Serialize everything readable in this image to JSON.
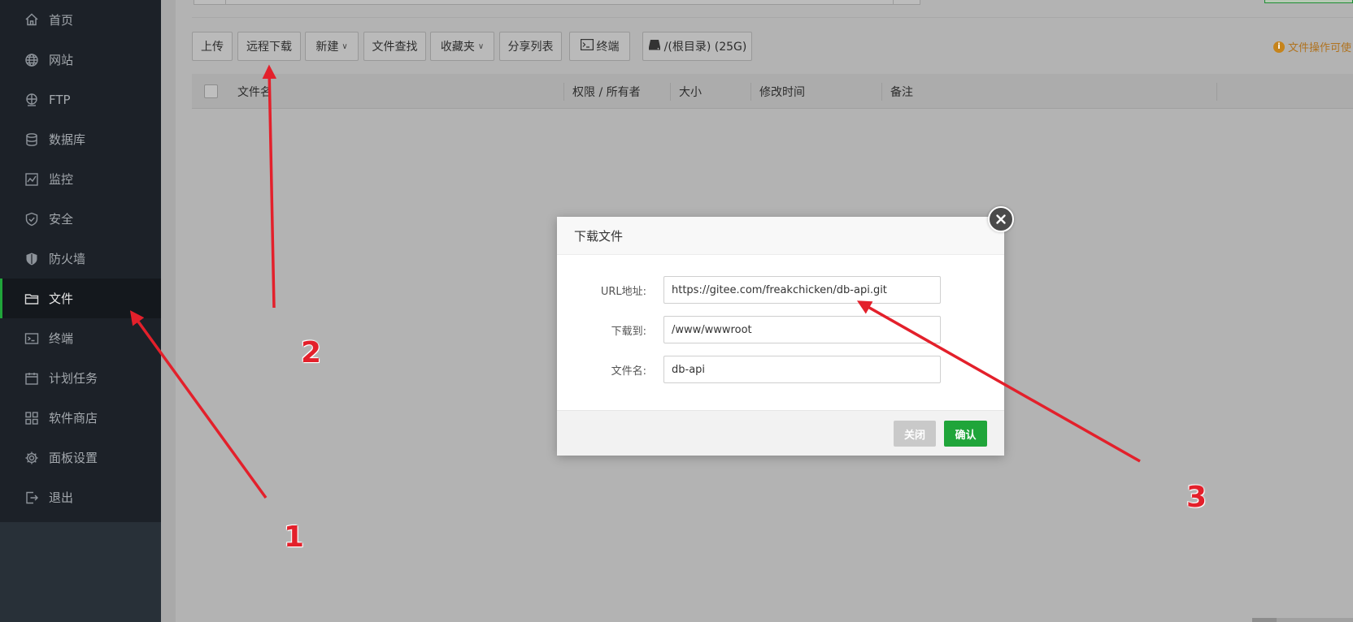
{
  "sidebar": {
    "items": [
      {
        "label": "首页",
        "icon": "home-icon"
      },
      {
        "label": "网站",
        "icon": "globe-icon"
      },
      {
        "label": "FTP",
        "icon": "ftp-icon"
      },
      {
        "label": "数据库",
        "icon": "database-icon"
      },
      {
        "label": "监控",
        "icon": "monitor-icon"
      },
      {
        "label": "安全",
        "icon": "shield-icon"
      },
      {
        "label": "防火墙",
        "icon": "firewall-icon"
      },
      {
        "label": "文件",
        "icon": "folder-icon",
        "active": true
      },
      {
        "label": "终端",
        "icon": "terminal-icon"
      },
      {
        "label": "计划任务",
        "icon": "calendar-icon"
      },
      {
        "label": "软件商店",
        "icon": "apps-icon"
      },
      {
        "label": "面板设置",
        "icon": "gear-icon"
      },
      {
        "label": "退出",
        "icon": "logout-icon"
      }
    ]
  },
  "toolbar": {
    "upload": "上传",
    "remote_download": "远程下载",
    "new": "新建",
    "file_search": "文件查找",
    "favorites": "收藏夹",
    "share_list": "分享列表",
    "terminal": "终端",
    "disk": "/(根目录) (25G)",
    "notice": "文件操作可使"
  },
  "table": {
    "columns": [
      "文件名",
      "权限 / 所有者",
      "大小",
      "修改时间",
      "备注"
    ]
  },
  "dialog": {
    "title": "下载文件",
    "url_label": "URL地址:",
    "url_value": "https://gitee.com/freakchicken/db-api.git",
    "dest_label": "下载到:",
    "dest_value": "/www/wwwroot",
    "filename_label": "文件名:",
    "filename_value": "db-api",
    "close_label": "关闭",
    "confirm_label": "确认"
  },
  "annotations": {
    "step1": "1",
    "step2": "2",
    "step3": "3",
    "color": "#e3202b"
  },
  "colors": {
    "accent": "#20a53a",
    "sidebar_bg": "#1c2128",
    "notice": "#b07320"
  }
}
